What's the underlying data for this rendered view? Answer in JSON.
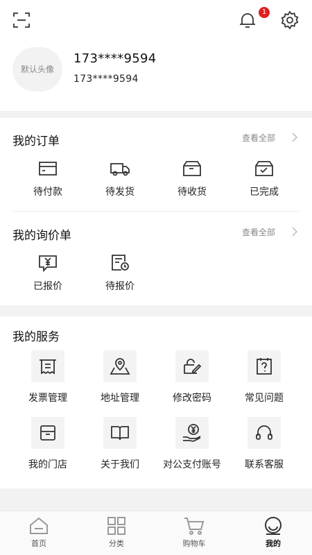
{
  "header": {
    "scan_icon": "scan-icon",
    "bell_icon": "bell-icon",
    "notification_count": "1",
    "settings_icon": "gear-icon"
  },
  "profile": {
    "avatar_text": "默认头像",
    "name": "173****9594",
    "phone": "173****9594"
  },
  "orders": {
    "title": "我的订单",
    "view_all": "查看全部",
    "items": [
      {
        "label": "待付款",
        "icon": "card-icon"
      },
      {
        "label": "待发货",
        "icon": "truck-icon"
      },
      {
        "label": "待收货",
        "icon": "package-icon"
      },
      {
        "label": "已完成",
        "icon": "box-check-icon"
      }
    ]
  },
  "inquiry": {
    "title": "我的询价单",
    "view_all": "查看全部",
    "items": [
      {
        "label": "已报价",
        "icon": "yen-chat-icon"
      },
      {
        "label": "待报价",
        "icon": "doc-clock-icon"
      }
    ]
  },
  "services": {
    "title": "我的服务",
    "items": [
      {
        "label": "发票管理",
        "icon": "invoice-icon"
      },
      {
        "label": "地址管理",
        "icon": "map-pin-icon"
      },
      {
        "label": "修改密码",
        "icon": "edit-password-icon"
      },
      {
        "label": "常见问题",
        "icon": "faq-icon"
      },
      {
        "label": "我的门店",
        "icon": "store-icon"
      },
      {
        "label": "关于我们",
        "icon": "book-icon"
      },
      {
        "label": "对公支付账号",
        "icon": "yen-hand-icon"
      },
      {
        "label": "联系客服",
        "icon": "headset-icon"
      }
    ]
  },
  "tabbar": {
    "active": "我的",
    "items": [
      {
        "label": "首页",
        "icon": "home-icon"
      },
      {
        "label": "分类",
        "icon": "grid-icon"
      },
      {
        "label": "购物车",
        "icon": "cart-icon"
      },
      {
        "label": "我的",
        "icon": "profile-icon"
      }
    ]
  }
}
